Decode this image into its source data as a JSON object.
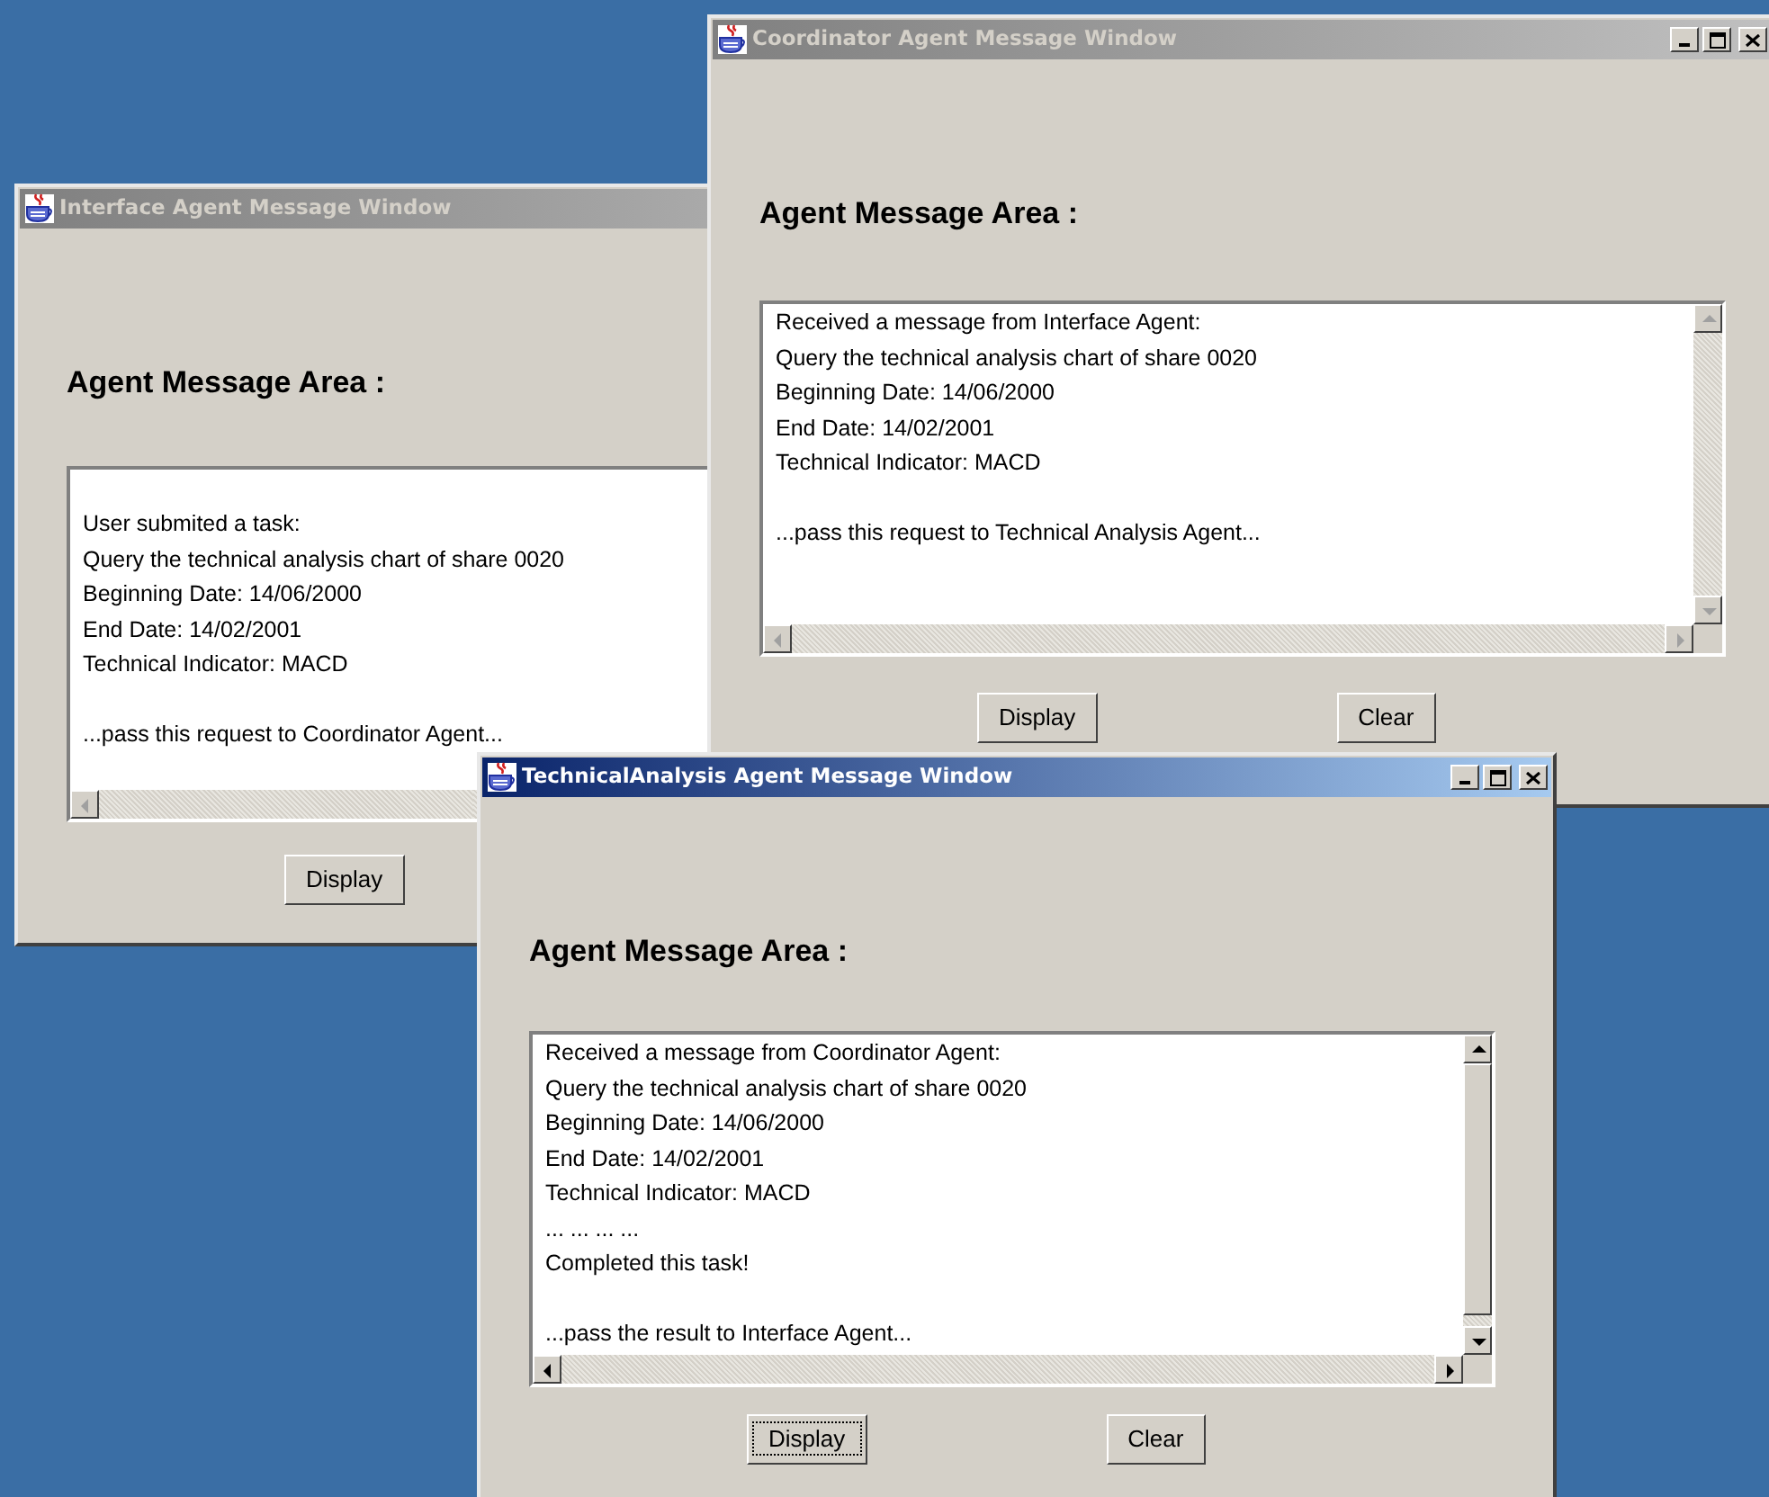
{
  "windows": [
    {
      "title": "Interface Agent Message Window",
      "active": false,
      "heading": "Agent Message Area :",
      "message": [
        [
          "User submited a task:",
          "Query the technical analysis chart of share 0020",
          "Beginning Date: 14/06/2000",
          "End Date: 14/02/2001",
          "Technical Indicator: MACD"
        ],
        [
          "...pass this request to Coordinator Agent..."
        ]
      ],
      "buttons": [
        {
          "label": "Display",
          "focused": false
        }
      ]
    },
    {
      "title": "Coordinator Agent Message Window",
      "active": false,
      "title_buttons": true,
      "heading": "Agent Message Area :",
      "message": [
        [
          "Received a message from Interface Agent:",
          "Query the technical analysis chart of share 0020",
          "Beginning Date: 14/06/2000",
          "End Date: 14/02/2001",
          "Technical Indicator: MACD"
        ],
        [
          "...pass this request to Technical Analysis Agent..."
        ]
      ],
      "buttons": [
        {
          "label": "Display",
          "focused": false
        },
        {
          "label": "Clear",
          "focused": false
        }
      ]
    },
    {
      "title": "TechnicalAnalysis Agent Message Window",
      "active": true,
      "title_buttons": true,
      "heading": "Agent Message Area :",
      "message": [
        [
          "Received a message from Coordinator Agent:",
          "Query the technical analysis chart of share 0020",
          "Beginning Date: 14/06/2000",
          "End Date: 14/02/2001",
          "Technical Indicator: MACD",
          "... ... ... ...",
          "Completed this task!"
        ],
        [
          "...pass the result to Interface Agent..."
        ]
      ],
      "buttons": [
        {
          "label": "Display",
          "focused": true
        },
        {
          "label": "Clear",
          "focused": false
        }
      ]
    }
  ]
}
